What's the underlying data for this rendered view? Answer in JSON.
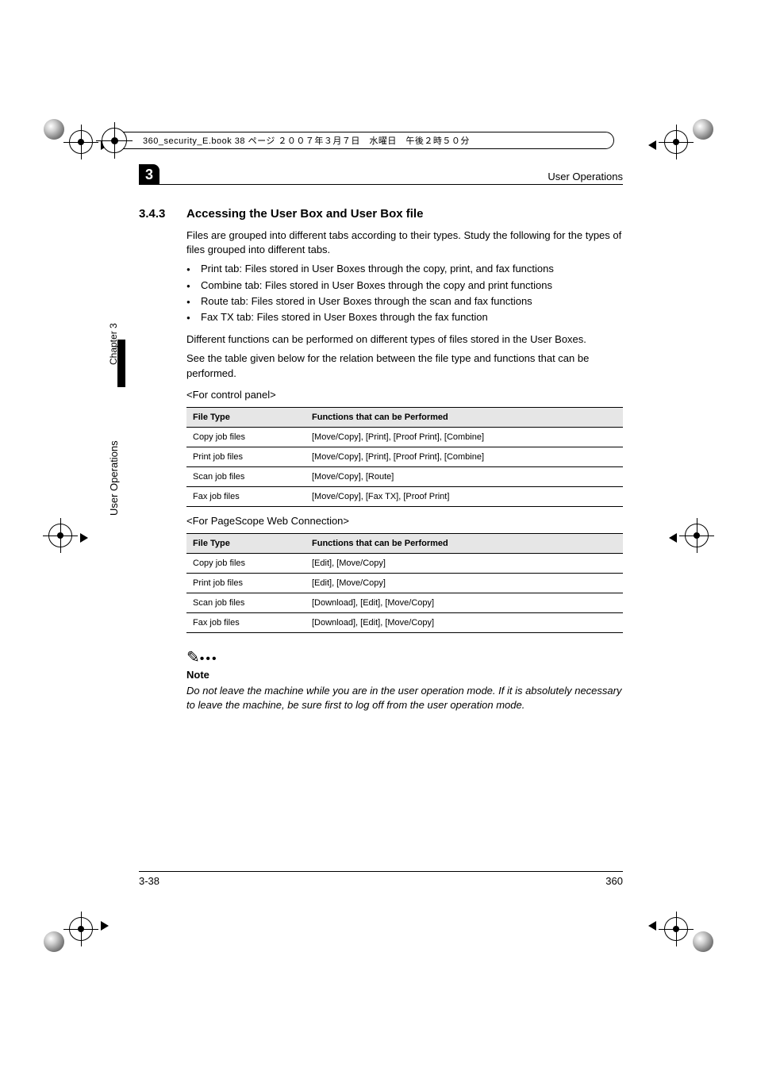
{
  "topbar": "360_security_E.book  38 ページ  ２００７年３月７日　水曜日　午後２時５０分",
  "running_head": "User Operations",
  "chapter_number": "3",
  "side_chapter": "Chapter 3",
  "side_title": "User Operations",
  "section": {
    "num": "3.4.3",
    "title": "Accessing the User Box and User Box file"
  },
  "intro": "Files are grouped into different tabs according to their types. Study the following for the types of files grouped into different tabs.",
  "bullets": [
    "Print tab: Files stored in User Boxes through the copy, print, and fax functions",
    "Combine tab: Files stored in User Boxes through the copy and print functions",
    "Route tab: Files stored in User Boxes through the scan and fax functions",
    "Fax TX tab: Files stored in User Boxes through the fax function"
  ],
  "para2a": "Different functions can be performed on different types of files stored in the User Boxes.",
  "para2b": "See the table given below for the relation between the file type and functions that can be performed.",
  "sub1": "<For control panel>",
  "table1": {
    "h1": "File Type",
    "h2": "Functions that can be Performed",
    "rows": [
      {
        "c1": "Copy job files",
        "c2": "[Move/Copy], [Print], [Proof Print], [Combine]"
      },
      {
        "c1": "Print job files",
        "c2": "[Move/Copy], [Print], [Proof Print], [Combine]"
      },
      {
        "c1": "Scan job files",
        "c2": "[Move/Copy], [Route]"
      },
      {
        "c1": "Fax job files",
        "c2": "[Move/Copy], [Fax TX], [Proof Print]"
      }
    ]
  },
  "sub2": "<For PageScope Web Connection>",
  "table2": {
    "h1": "File Type",
    "h2": "Functions that can be Performed",
    "rows": [
      {
        "c1": "Copy job files",
        "c2": "[Edit], [Move/Copy]"
      },
      {
        "c1": "Print job files",
        "c2": "[Edit], [Move/Copy]"
      },
      {
        "c1": "Scan job files",
        "c2": "[Download], [Edit], [Move/Copy]"
      },
      {
        "c1": "Fax job files",
        "c2": "[Download], [Edit], [Move/Copy]"
      }
    ]
  },
  "note": {
    "label": "Note",
    "text": "Do not leave the machine while you are in the user operation mode. If it is absolutely necessary to leave the machine, be sure first to log off from the user operation mode."
  },
  "footer": {
    "left": "3-38",
    "right": "360"
  }
}
